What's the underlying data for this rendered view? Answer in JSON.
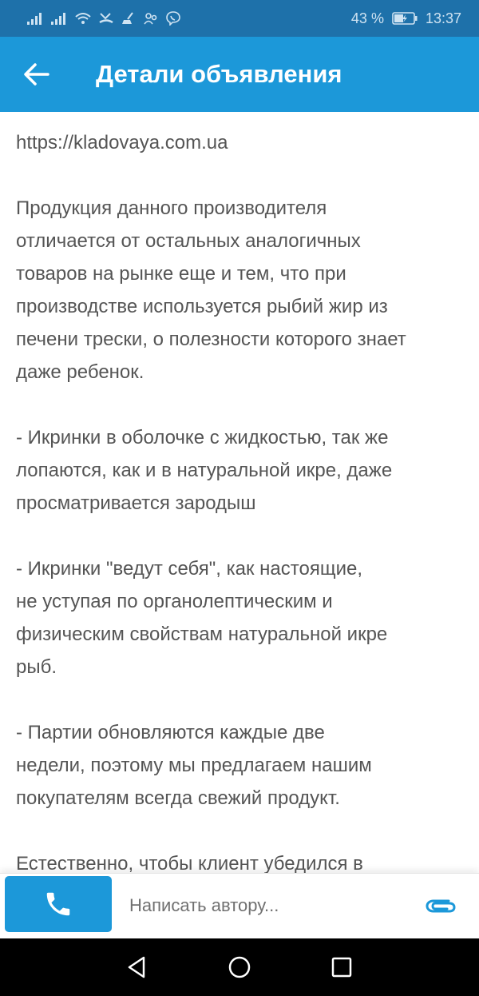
{
  "status_bar": {
    "battery": "43 %",
    "time": "13:37"
  },
  "header": {
    "title": "Детали объявления"
  },
  "content": {
    "paragraphs": [
      "https://kladovaya.com.ua",
      "Продукция данного производителя\nотличается от остальных аналогичных\nтоваров на рынке еще и тем, что при\nпроизводстве используется рыбий жир из\nпечени трески, о полезности которого знает\nдаже ребенок.",
      "- Икринки в оболочке с жидкостью, так же\nлопаются, как и в натуральной икре, даже\nпросматривается зародыш",
      "- Икринки \"ведут себя\", как настоящие,\nне уступая по органолептическим и\nфизическим свойствам натуральной икре\nрыб.",
      "- Партии обновляются каждые две\nнедели, поэтому мы предлагаем нашим\nпокупателям всегда свежий продукт.",
      "Естественно, чтобы клиент убедился в"
    ]
  },
  "bottom_bar": {
    "message_placeholder": "Написать автору..."
  },
  "icons": {
    "back": "arrow-left-icon",
    "call": "phone-icon",
    "attach": "paperclip-icon"
  },
  "colors": {
    "status_bar": "#1e71aa",
    "app_bar": "#1c98d9",
    "text": "#555555"
  }
}
